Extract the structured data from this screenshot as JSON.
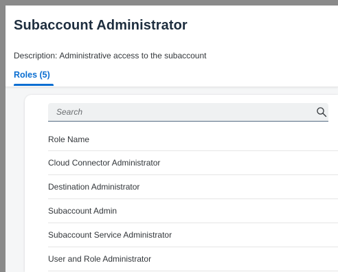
{
  "header": {
    "title": "Subaccount Administrator",
    "description_label": "Description:",
    "description_value": "Administrative access to the subaccount"
  },
  "tabs": [
    {
      "label": "Roles (5)",
      "active": true
    }
  ],
  "search": {
    "placeholder": "Search",
    "value": ""
  },
  "table": {
    "columns": [
      "Role Name"
    ],
    "rows": [
      "Cloud Connector Administrator",
      "Destination Administrator",
      "Subaccount Admin",
      "Subaccount Service Administrator",
      "User and Role Administrator"
    ]
  },
  "colors": {
    "accent": "#0a6ed1",
    "title_text": "#1d2d3e",
    "body_text": "#32363a",
    "page_background": "#f5f6f7"
  }
}
